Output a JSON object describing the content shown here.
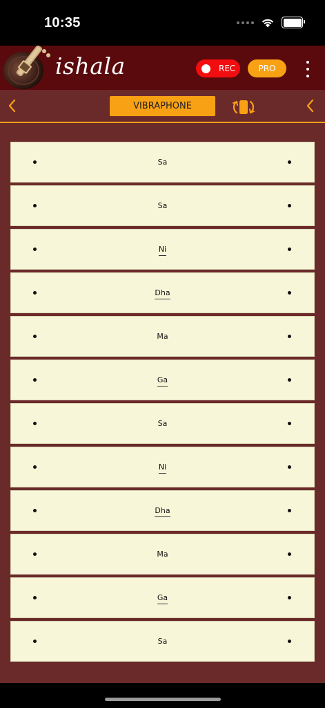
{
  "status_bar": {
    "time": "10:35"
  },
  "header": {
    "app_name": "ishala",
    "rec_label": "REC",
    "pro_label": "PRO",
    "menu_icon": "more-vertical-icon"
  },
  "toolbar": {
    "instrument": "VIBRAPHONE",
    "left_icon": "chevron-left-icon",
    "right_icon": "chevron-left-icon",
    "rotate_icon": "rotate-icon"
  },
  "notes": [
    {
      "label": "Sa",
      "underlined": false
    },
    {
      "label": "Sa",
      "underlined": false
    },
    {
      "label": "Ni",
      "underlined": true
    },
    {
      "label": "Dha",
      "underlined": true
    },
    {
      "label": "Ma",
      "underlined": false
    },
    {
      "label": "Ga",
      "underlined": true
    },
    {
      "label": "Sa",
      "underlined": false
    },
    {
      "label": "Ni",
      "underlined": true
    },
    {
      "label": "Dha",
      "underlined": true
    },
    {
      "label": "Ma",
      "underlined": false
    },
    {
      "label": "Ga",
      "underlined": true
    },
    {
      "label": "Sa",
      "underlined": false
    }
  ],
  "colors": {
    "header_bg": "#5a0a0c",
    "panel_bg": "#6b2a2a",
    "accent": "#f9a114",
    "rec": "#f10d10",
    "row_bg": "#f7f6d9"
  }
}
